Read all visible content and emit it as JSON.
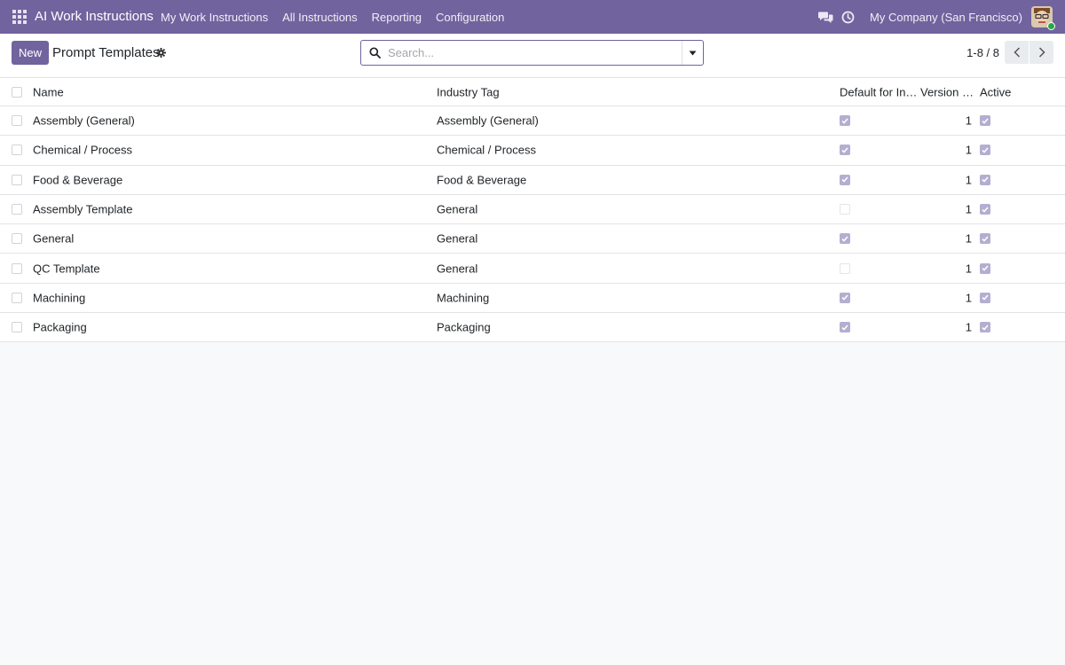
{
  "navbar": {
    "brand": "AI Work Instructions",
    "menu": [
      "My Work Instructions",
      "All Instructions",
      "Reporting",
      "Configuration"
    ],
    "company": "My Company (San Francisco)"
  },
  "control": {
    "new_label": "New",
    "title": "Prompt Templates",
    "search_placeholder": "Search...",
    "pager": "1-8 / 8"
  },
  "list": {
    "columns": {
      "name": "Name",
      "industry_tag": "Industry Tag",
      "default": "Default for In…",
      "version": "Version …",
      "active": "Active"
    },
    "rows": [
      {
        "name": "Assembly (General)",
        "tag": "Assembly (General)",
        "default": true,
        "version": "1",
        "active": true
      },
      {
        "name": "Chemical / Process",
        "tag": "Chemical / Process",
        "default": true,
        "version": "1",
        "active": true
      },
      {
        "name": "Food & Beverage",
        "tag": "Food & Beverage",
        "default": true,
        "version": "1",
        "active": true
      },
      {
        "name": "Assembly Template",
        "tag": "General",
        "default": false,
        "version": "1",
        "active": true
      },
      {
        "name": "General",
        "tag": "General",
        "default": true,
        "version": "1",
        "active": true
      },
      {
        "name": "QC Template",
        "tag": "General",
        "default": false,
        "version": "1",
        "active": true
      },
      {
        "name": "Machining",
        "tag": "Machining",
        "default": true,
        "version": "1",
        "active": true
      },
      {
        "name": "Packaging",
        "tag": "Packaging",
        "default": true,
        "version": "1",
        "active": true
      }
    ]
  },
  "colors": {
    "brand": "#71639e",
    "checkbox_checked": "#b4aed0"
  }
}
